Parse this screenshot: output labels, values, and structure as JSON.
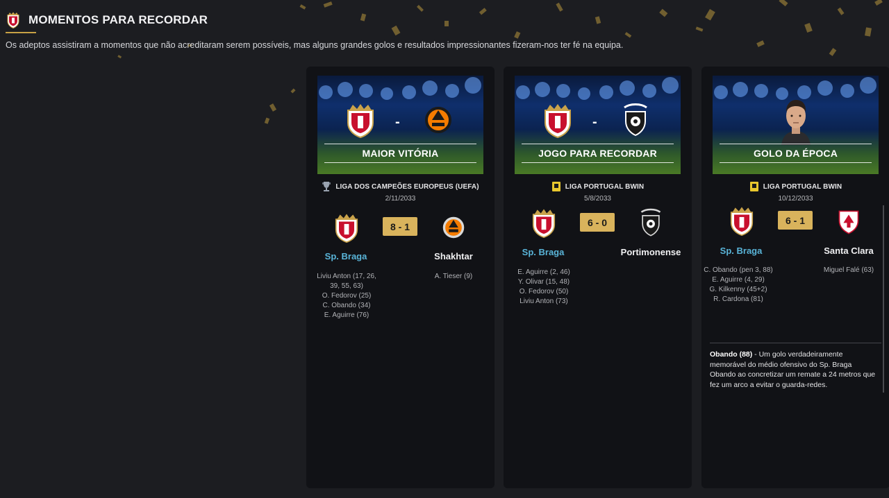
{
  "header": {
    "title": "MOMENTOS PARA RECORDAR",
    "description": "Os adeptos assistiram a momentos que não acreditaram serem possíveis, mas alguns grandes golos e resultados impressionantes fizeram-nos ter fé na equipa."
  },
  "colors": {
    "accent": "#d9b35c",
    "home_team": "#59b4d8",
    "card_bg": "#111216",
    "page_bg": "#1c1d21"
  },
  "cards": [
    {
      "banner_label": "MAIOR VITÓRIA",
      "banner_dash": "-",
      "competition_icon": "champions-trophy-icon",
      "competition": "LIGA DOS CAMPEÕES EUROPEUS (UEFA)",
      "date": "2/11/2033",
      "score": "8 - 1",
      "home_team": "Sp. Braga",
      "away_team": "Shakhtar",
      "home_scorers": [
        "Liviu Anton (17, 26,",
        "39, 55, 63)",
        "O. Fedorov (25)",
        "C. Obando (34)",
        "E. Aguirre (76)"
      ],
      "away_scorers": [
        "A. Tieser (9)"
      ]
    },
    {
      "banner_label": "JOGO PARA RECORDAR",
      "banner_dash": "-",
      "competition_icon": "liga-portugal-icon",
      "competition": "LIGA PORTUGAL BWIN",
      "date": "5/8/2033",
      "score": "6 - 0",
      "home_team": "Sp. Braga",
      "away_team": "Portimonense",
      "home_scorers": [
        "E. Aguirre (2, 46)",
        "Y. Olivar (15, 48)",
        "O. Fedorov (50)",
        "Liviu Anton (73)"
      ],
      "away_scorers": []
    },
    {
      "banner_label": "GOLO DA ÉPOCA",
      "competition_icon": "liga-portugal-icon",
      "competition": "LIGA PORTUGAL BWIN",
      "date": "10/12/2033",
      "score": "6 - 1",
      "home_team": "Sp. Braga",
      "away_team": "Santa Clara",
      "home_scorers": [
        "C. Obando (pen 3, 88)",
        "E. Aguirre (4, 29)",
        "G. Kilkenny (45+2)",
        "R. Cardona (81)"
      ],
      "away_scorers": [
        "Miguel Falé (63)"
      ],
      "goal_title": "Obando (88)",
      "goal_text": " - Um golo verdadeiramente memorável do médio ofensivo do Sp. Braga Obando ao concretizar um remate a 24 metros que fez um arco a evitar o guarda-redes."
    }
  ]
}
